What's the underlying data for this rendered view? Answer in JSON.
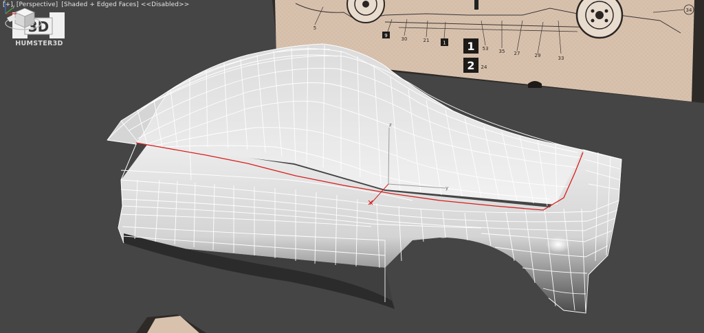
{
  "viewport": {
    "labels": [
      "[+]",
      "[Perspective]",
      "[Shaded + Edged Faces]",
      "<<Disabled>>"
    ]
  },
  "watermark": {
    "logo_text": "3D",
    "brand": "HUMSTER3D"
  },
  "blueprint": {
    "callouts": [
      "5",
      "9",
      "30",
      "21",
      "1",
      "1",
      "53",
      "35",
      "27",
      "29",
      "33",
      "2",
      "24",
      "34"
    ]
  },
  "gizmo": {
    "axes": [
      "z",
      "y"
    ]
  },
  "axis_tripod": {
    "axes": [
      "x",
      "y",
      "z"
    ]
  },
  "colors": {
    "background": "#454545",
    "selection_edge": "#d81d1d",
    "wireframe": "#ffffff",
    "blueprint_paper": "#d8c2ae"
  }
}
